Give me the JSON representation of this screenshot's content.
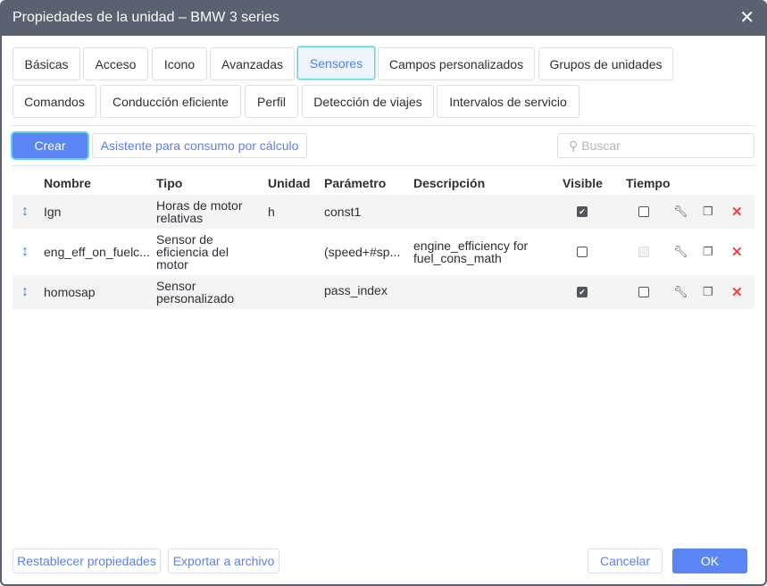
{
  "window": {
    "title": "Propiedades de la unidad – BMW 3 series"
  },
  "tabs": [
    "Básicas",
    "Acceso",
    "Icono",
    "Avanzadas",
    "Sensores",
    "Campos personalizados",
    "Grupos de unidades",
    "Comandos",
    "Conducción eficiente",
    "Perfil",
    "Detección de viajes",
    "Intervalos de servicio"
  ],
  "active_tab": "Sensores",
  "toolbar": {
    "create": "Crear",
    "wizard": "Asistente para consumo por cálculo",
    "search_placeholder": "Buscar"
  },
  "table": {
    "headers": {
      "name": "Nombre",
      "type": "Tipo",
      "unit": "Unidad",
      "param": "Parámetro",
      "desc": "Descripción",
      "visible": "Visible",
      "time": "Tiempo"
    },
    "rows": [
      {
        "name": "Ign",
        "type1": "Horas de motor",
        "type2": "relativas",
        "type3": "",
        "unit": "h",
        "param": "const1",
        "desc1": "",
        "desc2": "",
        "visible": true,
        "time": false
      },
      {
        "name": "eng_eff_on_fuelc...",
        "type1": "Sensor de",
        "type2": "eficiencia del",
        "type3": "motor",
        "unit": "",
        "param": "(speed+#sp...",
        "desc1": "engine_efficiency for",
        "desc2": "fuel_cons_math",
        "visible": false,
        "time": null
      },
      {
        "name": "homosap",
        "type1": "Sensor",
        "type2": "personalizado",
        "type3": "",
        "unit": "",
        "param": "pass_index",
        "desc1": "",
        "desc2": "",
        "visible": true,
        "time": false
      }
    ]
  },
  "footer": {
    "reset": "Restablecer propiedades",
    "export": "Exportar a archivo",
    "cancel": "Cancelar",
    "ok": "OK"
  },
  "colors": {
    "titlebar": "#5a6170",
    "accent": "#5b85f5",
    "focus": "#5fd3e8",
    "delete": "#f0433a"
  }
}
